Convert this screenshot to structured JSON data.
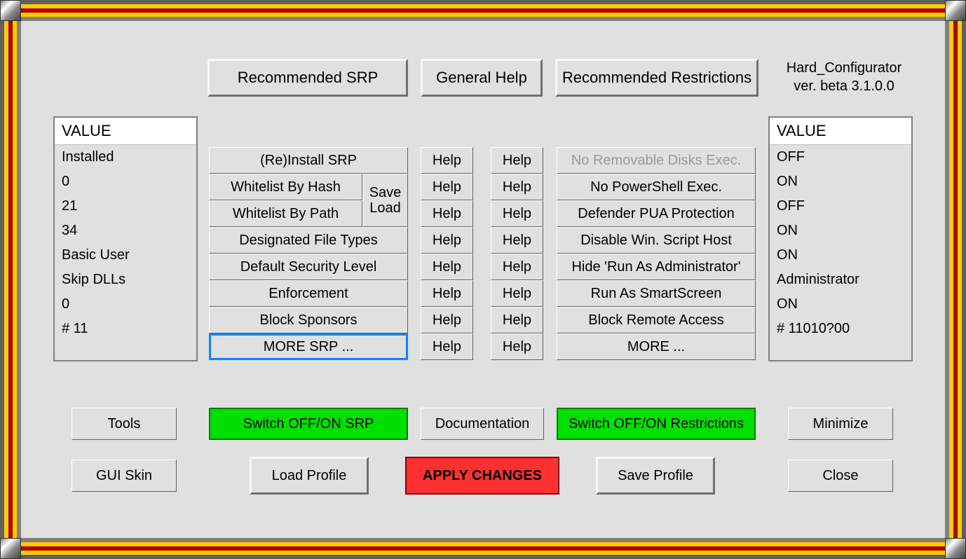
{
  "top_buttons": {
    "recommended_srp": "Recommended SRP",
    "general_help": "General Help",
    "recommended_restrictions": "Recommended Restrictions"
  },
  "title_line1": "Hard_Configurator",
  "title_line2": "ver. beta 3.1.0.0",
  "left_list": {
    "header": "VALUE",
    "items": [
      "Installed",
      "0",
      "21",
      "34",
      "Basic User",
      "Skip DLLs",
      "0",
      "# 11"
    ]
  },
  "right_list": {
    "header": "VALUE",
    "items": [
      "OFF",
      "ON",
      "OFF",
      "ON",
      "ON",
      "Administrator",
      "ON",
      "# 11010?00"
    ]
  },
  "srp_col": [
    "(Re)Install SRP",
    "Whitelist By Hash",
    "Whitelist By Path",
    "Designated File Types",
    "Default Security Level",
    "Enforcement",
    "Block Sponsors",
    "MORE SRP ..."
  ],
  "save_load": {
    "line1": "Save",
    "line2": "Load"
  },
  "help_label": "Help",
  "restr_col": [
    "No Removable Disks Exec.",
    "No PowerShell Exec.",
    "Defender PUA Protection",
    "Disable Win. Script Host",
    "Hide  'Run As Administrator'",
    "Run As SmartScreen",
    "Block Remote Access",
    "MORE ..."
  ],
  "bottom_row1": {
    "tools": "Tools",
    "switch_srp": "Switch OFF/ON SRP",
    "documentation": "Documentation",
    "switch_restrictions": "Switch OFF/ON Restrictions",
    "minimize": "Minimize"
  },
  "bottom_row2": {
    "gui_skin": "GUI Skin",
    "load_profile": "Load Profile",
    "apply_changes": "APPLY CHANGES",
    "save_profile": "Save Profile",
    "close": "Close"
  }
}
